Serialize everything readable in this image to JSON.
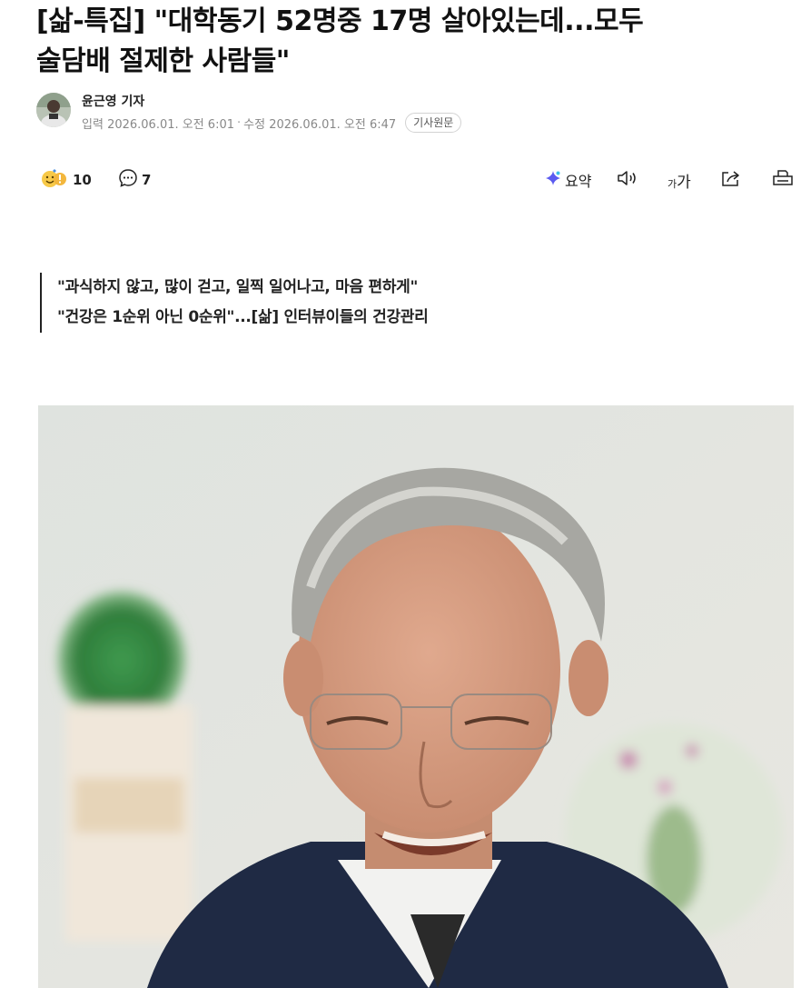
{
  "headline": {
    "line1": "[삶-특집] \"대학동기 52명중 17명 살아있는데...모두",
    "line2": "술담배 절제한 사람들\""
  },
  "byline": {
    "author": "윤근영 기자",
    "input_label": "입력",
    "input_time": "2026.06.01. 오전 6:01",
    "separator": "·",
    "modified_label": "수정",
    "modified_time": "2026.06.01. 오전 6:47",
    "source_button": "기사원문"
  },
  "toolbar": {
    "reaction_count": "10",
    "comment_count": "7",
    "summary_label": "요약",
    "font_size_label": "가가"
  },
  "subheadlines": [
    "\"과식하지 않고, 많이 걷고, 일찍 일어나고, 마음 편하게\"",
    "\"건강은 1순위 아닌 0순위\"...[삶] 인터뷰이들의 건강관리"
  ],
  "colors": {
    "text": "#111111",
    "meta": "#888888",
    "summary_accent": "#5b5bf0"
  },
  "icons": [
    "reaction-emoji-icon",
    "comment-icon",
    "summary-sparkle-icon",
    "speaker-icon",
    "font-size-icon",
    "share-icon",
    "print-icon"
  ]
}
